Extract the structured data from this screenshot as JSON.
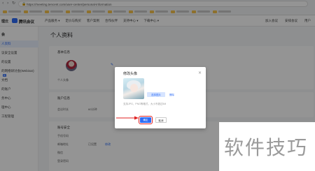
{
  "browser": {
    "url": "https://meeting.tencent.com/user-center/personal-information",
    "bookmark_count": 11
  },
  "topnav": {
    "cut_label": "理云",
    "brand": "腾讯会议",
    "menu": [
      "产品服务 ▾",
      "定价与购买",
      "客户案例",
      "合作伙伴",
      "支持中心 ▾",
      "下载中心 ▾"
    ],
    "right": [
      "加入会议",
      "安排会议",
      "用户"
    ]
  },
  "sidebar": {
    "head": "会",
    "items": [
      "人资料",
      "议安全设置",
      "的设置",
      "的网络研讨会(Webinar)",
      "文档",
      "的账户",
      "务中心",
      "理中心",
      "工程管理"
    ],
    "tag": "新"
  },
  "main": {
    "title": "个人资料",
    "basic_title": "基本信息",
    "name_blur": "",
    "avatar_label": "个人头像",
    "account_title": "账户信息",
    "account_type_label": "账户类型",
    "meeting_label": "会议时长",
    "meeting_value": "60分钟",
    "security_title": "账号安全",
    "phone_label": "手机号码",
    "email_label": "邮箱地址",
    "wechat_label": "微信",
    "password_label": "登录密码",
    "bound": "已设置",
    "modify": "修改"
  },
  "dialog": {
    "title": "修改头像",
    "close": "×",
    "upload": "选择图片",
    "delete": "删除",
    "hint": "支持JPG、PNG等格式，大小不超过5M",
    "confirm": "确定",
    "cancel": "取消"
  },
  "watermark": "软件技巧",
  "colors": {
    "accent": "#2d6cf6",
    "highlight": "#e02020"
  }
}
